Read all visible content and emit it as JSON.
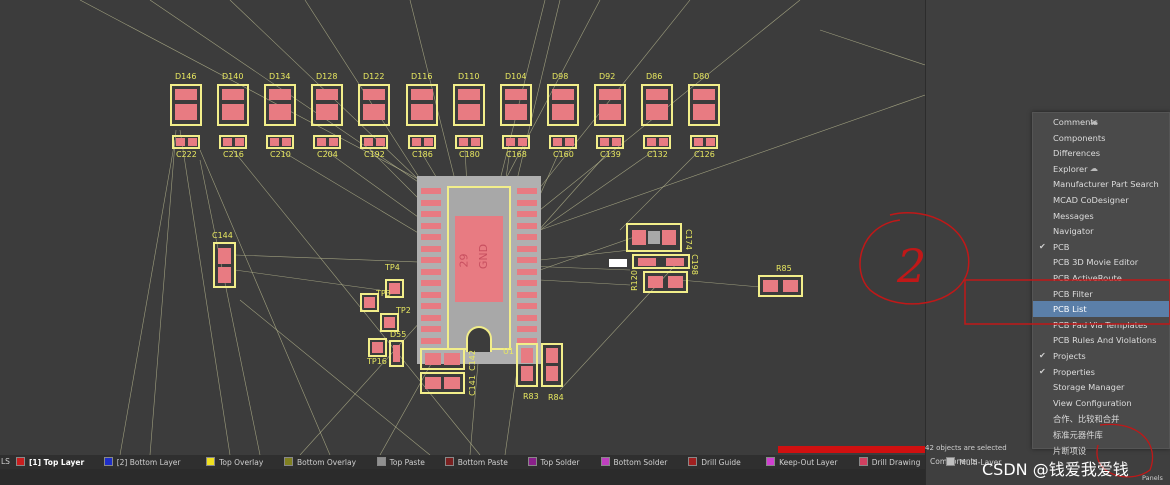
{
  "pcb": {
    "top_diodes": [
      "D146",
      "D140",
      "D134",
      "D128",
      "D122",
      "D116",
      "D110",
      "D104",
      "D98",
      "D92",
      "D86",
      "D80"
    ],
    "top_caps": [
      "C222",
      "C216",
      "C210",
      "C204",
      "C192",
      "C186",
      "C180",
      "C168",
      "C160",
      "C139",
      "C132",
      "C126"
    ],
    "labels": {
      "c144": "C144",
      "tp4": "TP4",
      "tp3": "TP3",
      "tp2": "TP2",
      "d55": "D55",
      "tp16": "TP16",
      "c142": "C142",
      "c141": "C141",
      "u1": "U1",
      "r83": "R83",
      "r84": "R84",
      "c174": "C174",
      "c198": "C198",
      "r120": "R120",
      "r85": "R85",
      "ic_net": "GND",
      "ic_num": "29"
    }
  },
  "panel_menu": {
    "items": [
      {
        "label": "Comments",
        "checked": false,
        "cloud": true,
        "selected": false
      },
      {
        "label": "Components",
        "checked": false,
        "cloud": false,
        "selected": false
      },
      {
        "label": "Differences",
        "checked": false,
        "cloud": false,
        "selected": false
      },
      {
        "label": "Explorer",
        "checked": false,
        "cloud": true,
        "selected": false
      },
      {
        "label": "Manufacturer Part Search",
        "checked": false,
        "cloud": false,
        "selected": false
      },
      {
        "label": "MCAD CoDesigner",
        "checked": false,
        "cloud": false,
        "selected": false
      },
      {
        "label": "Messages",
        "checked": false,
        "cloud": false,
        "selected": false
      },
      {
        "label": "Navigator",
        "checked": false,
        "cloud": false,
        "selected": false
      },
      {
        "label": "PCB",
        "checked": true,
        "cloud": false,
        "selected": false
      },
      {
        "label": "PCB 3D Movie Editor",
        "checked": false,
        "cloud": false,
        "selected": false
      },
      {
        "label": "PCB ActiveRoute",
        "checked": false,
        "cloud": false,
        "selected": false
      },
      {
        "label": "PCB Filter",
        "checked": false,
        "cloud": false,
        "selected": false
      },
      {
        "label": "PCB List",
        "checked": false,
        "cloud": false,
        "selected": true
      },
      {
        "label": "PCB Pad Via Templates",
        "checked": false,
        "cloud": false,
        "selected": false
      },
      {
        "label": "PCB Rules And Violations",
        "checked": false,
        "cloud": false,
        "selected": false
      },
      {
        "label": "Projects",
        "checked": true,
        "cloud": false,
        "selected": false
      },
      {
        "label": "Properties",
        "checked": true,
        "cloud": false,
        "selected": false
      },
      {
        "label": "Storage Manager",
        "checked": false,
        "cloud": false,
        "selected": false
      },
      {
        "label": "View Configuration",
        "checked": false,
        "cloud": false,
        "selected": false
      },
      {
        "label": "合作、比较和合并",
        "checked": false,
        "cloud": false,
        "selected": false
      },
      {
        "label": "标准元器件库",
        "checked": false,
        "cloud": false,
        "selected": false
      },
      {
        "label": "片断项设",
        "checked": false,
        "cloud": false,
        "selected": false
      }
    ]
  },
  "layer_bar": {
    "prefix": "LS",
    "layers": [
      {
        "label": "[1] Top Layer",
        "color": "#c81e1e",
        "active": true
      },
      {
        "label": "[2] Bottom Layer",
        "color": "#1e2ec8",
        "active": false
      },
      {
        "label": "Top Overlay",
        "color": "#f0e020",
        "active": false
      },
      {
        "label": "Bottom Overlay",
        "color": "#808020",
        "active": false
      },
      {
        "label": "Top Paste",
        "color": "#909090",
        "active": false
      },
      {
        "label": "Bottom Paste",
        "color": "#7a2020",
        "active": false
      },
      {
        "label": "Top Solder",
        "color": "#8a208a",
        "active": false
      },
      {
        "label": "Bottom Solder",
        "color": "#c040c0",
        "active": false
      },
      {
        "label": "Drill Guide",
        "color": "#a02020",
        "active": false
      },
      {
        "label": "Keep-Out Layer",
        "color": "#d040d0",
        "active": false
      },
      {
        "label": "Drill Drawing",
        "color": "#d04060",
        "active": false
      },
      {
        "label": "Multi-Layer",
        "color": "#c0c0c0",
        "active": false
      }
    ]
  },
  "status": {
    "selection": "42 objects are selected",
    "tab_components": "Components",
    "tab_panels": "Panels"
  },
  "annotation": {
    "number": "2"
  },
  "watermark": "CSDN @钱爱我爱钱",
  "colors": {
    "silkscreen": "#f2ee8a",
    "pad": "#e87b82",
    "ratsnest": "#c8c89a",
    "highlight": "#5b7fa8"
  }
}
